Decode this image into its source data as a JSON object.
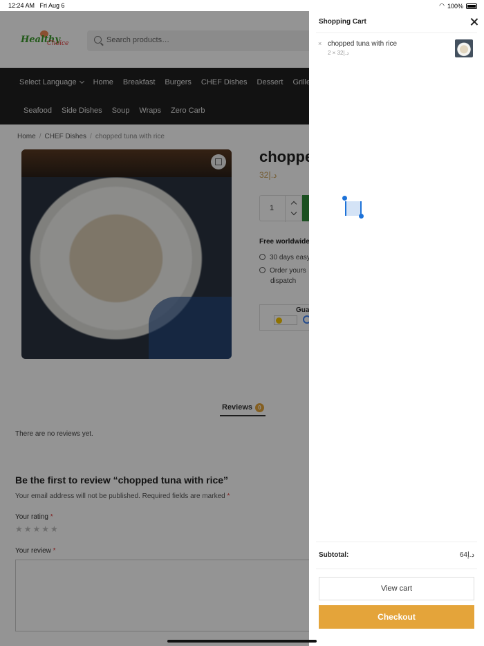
{
  "status_bar": {
    "time": "12:24 AM",
    "date": "Fri Aug 6",
    "battery": "100%"
  },
  "header": {
    "logo_text_1": "Healthy",
    "logo_text_2": "Choice",
    "search_placeholder": "Search products…"
  },
  "nav": {
    "row1": [
      "Select Language",
      "Home",
      "Breakfast",
      "Burgers",
      "CHEF Dishes",
      "Dessert",
      "Grilled"
    ],
    "row2": [
      "Seafood",
      "Side Dishes",
      "Soup",
      "Wraps",
      "Zero Carb"
    ]
  },
  "breadcrumb": {
    "home": "Home",
    "category": "CHEF Dishes",
    "current": "chopped tuna with rice"
  },
  "product": {
    "title": "chopped",
    "price": "32د.إ",
    "quantity": "1",
    "shipping_title": "Free worldwide",
    "shipping_items": [
      "30 days easy",
      "Order yours"
    ],
    "shipping_item2_cont": "dispatch",
    "guarantee_title": "Gua"
  },
  "reviews": {
    "tab_label": "Reviews",
    "count": "0",
    "empty_text": "There are no reviews yet.",
    "be_first": "Be the first to review “chopped tuna with rice”",
    "email_note": "Your email address will not be published. Required fields are marked",
    "required_mark": "*",
    "rating_label": "Your rating",
    "stars": "★★★★★",
    "review_label": "Your review"
  },
  "cart": {
    "title": "Shopping Cart",
    "remove_symbol": "×",
    "item_name": "chopped tuna with rice",
    "item_qty_price": "2 × 32د.إ",
    "subtotal_label": "Subtotal:",
    "subtotal_value": "64د.إ",
    "view_cart_label": "View cart",
    "checkout_label": "Checkout"
  },
  "colors": {
    "accent": "#e4a43a",
    "nav_bg": "#1f1f1f",
    "selection": "#1d72d8"
  }
}
